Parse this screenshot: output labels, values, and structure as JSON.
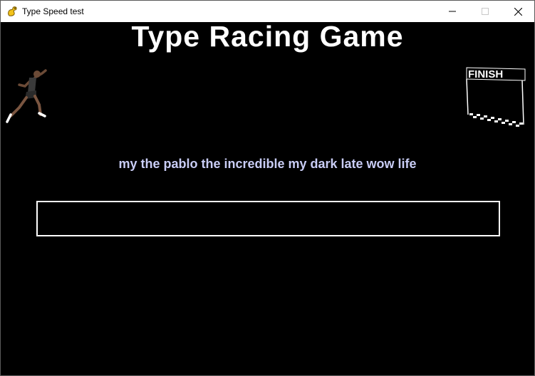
{
  "window": {
    "title": "Type Speed test",
    "app_icon": "pygame-snake-icon",
    "controls": [
      "minimize-icon",
      "maximize-icon",
      "close-icon"
    ]
  },
  "game": {
    "title": "Type Racing Game",
    "sentence": "my the pablo the incredible my dark late wow life",
    "input": {
      "value": ""
    },
    "finish_label": "FINISH",
    "colors": {
      "background": "#000000",
      "title": "#ffffff",
      "sentence": "#c9cdf5",
      "input_border": "#ffffff"
    }
  }
}
